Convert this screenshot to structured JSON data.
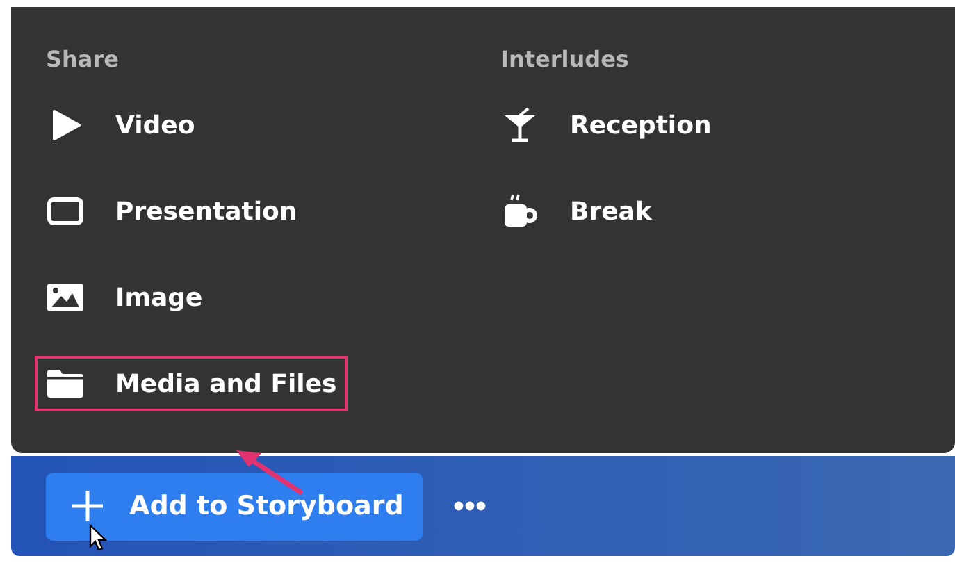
{
  "menu": {
    "sections": [
      {
        "heading": "Share",
        "items": [
          {
            "label": "Video",
            "highlighted": false
          },
          {
            "label": "Presentation",
            "highlighted": false
          },
          {
            "label": "Image",
            "highlighted": false
          },
          {
            "label": "Media and Files",
            "highlighted": true
          }
        ]
      },
      {
        "heading": "Interludes",
        "items": [
          {
            "label": "Reception",
            "highlighted": false
          },
          {
            "label": "Break",
            "highlighted": false
          }
        ]
      }
    ]
  },
  "toolbar": {
    "add_button": "Add to Storyboard"
  }
}
